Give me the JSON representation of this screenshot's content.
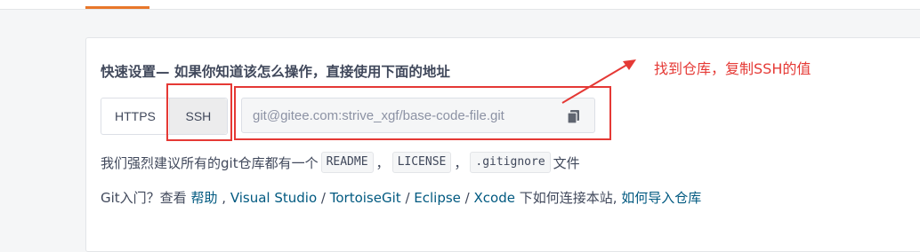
{
  "quick_setup": {
    "title": "快速设置— 如果你知道该怎么操作，直接使用下面的地址",
    "protocols": [
      "HTTPS",
      "SSH"
    ],
    "selected_protocol": "SSH",
    "repo_url": "git@gitee.com:strive_xgf/base-code-file.git"
  },
  "annotation": {
    "text": "找到仓库，复制SSH的值",
    "color": "#e53935"
  },
  "recommend": {
    "prefix": "我们强烈建议所有的git仓库都有一个",
    "files": [
      "README",
      "LICENSE",
      ".gitignore"
    ],
    "separator": "，",
    "suffix": "文件"
  },
  "help": {
    "prefix": "Git入门？查看",
    "link_help": "帮助",
    "tools": [
      "Visual Studio",
      "TortoiseGit",
      "Eclipse",
      "Xcode"
    ],
    "middle": "下如何连接本站,",
    "link_import": "如何导入仓库"
  },
  "colors": {
    "accent_orange": "#e8772a",
    "link": "#005980",
    "text": "#40485b"
  },
  "icons": {
    "copy": "copy-icon"
  }
}
